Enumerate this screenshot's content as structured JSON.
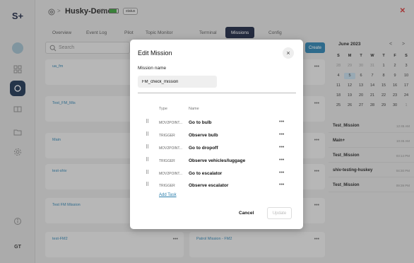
{
  "sidebar": {
    "logo": "S+",
    "user_initials": "GT"
  },
  "header": {
    "title": "Husky-Demo",
    "battery_percent": "87%",
    "battery_level": 0.87,
    "status_badge": "status"
  },
  "tabs": [
    {
      "label": "Overview"
    },
    {
      "label": "Event Log"
    },
    {
      "label": "Pilot"
    },
    {
      "label": "Topic Monitor"
    },
    {
      "label": "Terminal"
    },
    {
      "label": "Missions"
    },
    {
      "label": "Config"
    }
  ],
  "active_tab": "Missions",
  "search": {
    "placeholder": "Search"
  },
  "create_label": "Create",
  "missions": [
    {
      "name": "ua_fm"
    },
    {
      "name": "Test_FM_Mis"
    },
    {
      "name": "Main"
    },
    {
      "name": "test-shiv"
    },
    {
      "name": "Test FM Mission"
    },
    {
      "name": "test-FM2"
    },
    {
      "name": "Patrol Mission - FM2"
    }
  ],
  "calendar": {
    "month": "June 2023",
    "weekdays": [
      "S",
      "M",
      "T",
      "W",
      "T",
      "F",
      "S"
    ],
    "days": [
      "28",
      "29",
      "30",
      "31",
      "1",
      "2",
      "3",
      "4",
      "5",
      "6",
      "7",
      "8",
      "9",
      "10",
      "11",
      "12",
      "13",
      "14",
      "15",
      "16",
      "17",
      "18",
      "19",
      "20",
      "21",
      "22",
      "23",
      "24",
      "25",
      "26",
      "27",
      "28",
      "29",
      "30",
      "1"
    ],
    "selected_day": "5"
  },
  "upcoming": [
    {
      "name": "Test_Mission",
      "time": "12:45 AM"
    },
    {
      "name": "Main+",
      "time": "10:45 AM"
    },
    {
      "name": "Test_Mission",
      "time": "03:14 PM"
    },
    {
      "name": "shiv-testing-huskey",
      "time": "04:30 PM"
    },
    {
      "name": "Test_Mission",
      "time": "09:39 PM"
    }
  ],
  "modal": {
    "title": "Edit Mission",
    "close_icon": "×",
    "mission_name_label": "Mission name",
    "mission_name_value": "FM_check_mission",
    "col_type": "Type",
    "col_name": "Name",
    "tasks": [
      {
        "type": "MOV2POINT...",
        "name": "Go to bulb"
      },
      {
        "type": "TRIGGER",
        "name": "Observe bulb"
      },
      {
        "type": "MOV2POINT...",
        "name": "Go to dropoff"
      },
      {
        "type": "TRIGGER",
        "name": "Observe vehicles/luggage"
      },
      {
        "type": "MOV2POINT...",
        "name": "Go to escalator"
      },
      {
        "type": "TRIGGER",
        "name": "Observe escalator"
      }
    ],
    "add_task_label": "Add Task",
    "cancel_label": "Cancel",
    "update_label": "Update"
  },
  "colors": {
    "accent": "#2a7dab",
    "brand_dark": "#1b2440",
    "battery_green": "#3a9c3a"
  }
}
